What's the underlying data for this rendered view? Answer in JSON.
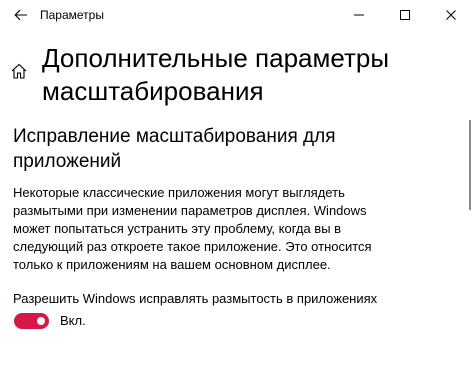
{
  "app": {
    "title": "Параметры"
  },
  "header": {
    "page_title": "Дополнительные параметры масштабирования"
  },
  "section": {
    "heading": "Исправление масштабирования для приложений",
    "description": "Некоторые классические приложения могут выглядеть размытыми при изменении параметров дисплея. Windows может попытаться устранить эту проблему, когда вы в следующий раз откроете такое приложение. Это относится только к приложениям на вашем основном дисплее.",
    "setting_label": "Разрешить Windows исправлять размытость в приложениях",
    "toggle": {
      "state_label": "Вкл.",
      "on": true
    }
  },
  "colors": {
    "accent": "#d7174a",
    "text": "#000000",
    "background": "#ffffff"
  },
  "icons": {
    "back": "arrow-left-icon",
    "home": "home-icon",
    "minimize": "minimize-icon",
    "maximize": "maximize-icon",
    "close": "close-icon"
  }
}
